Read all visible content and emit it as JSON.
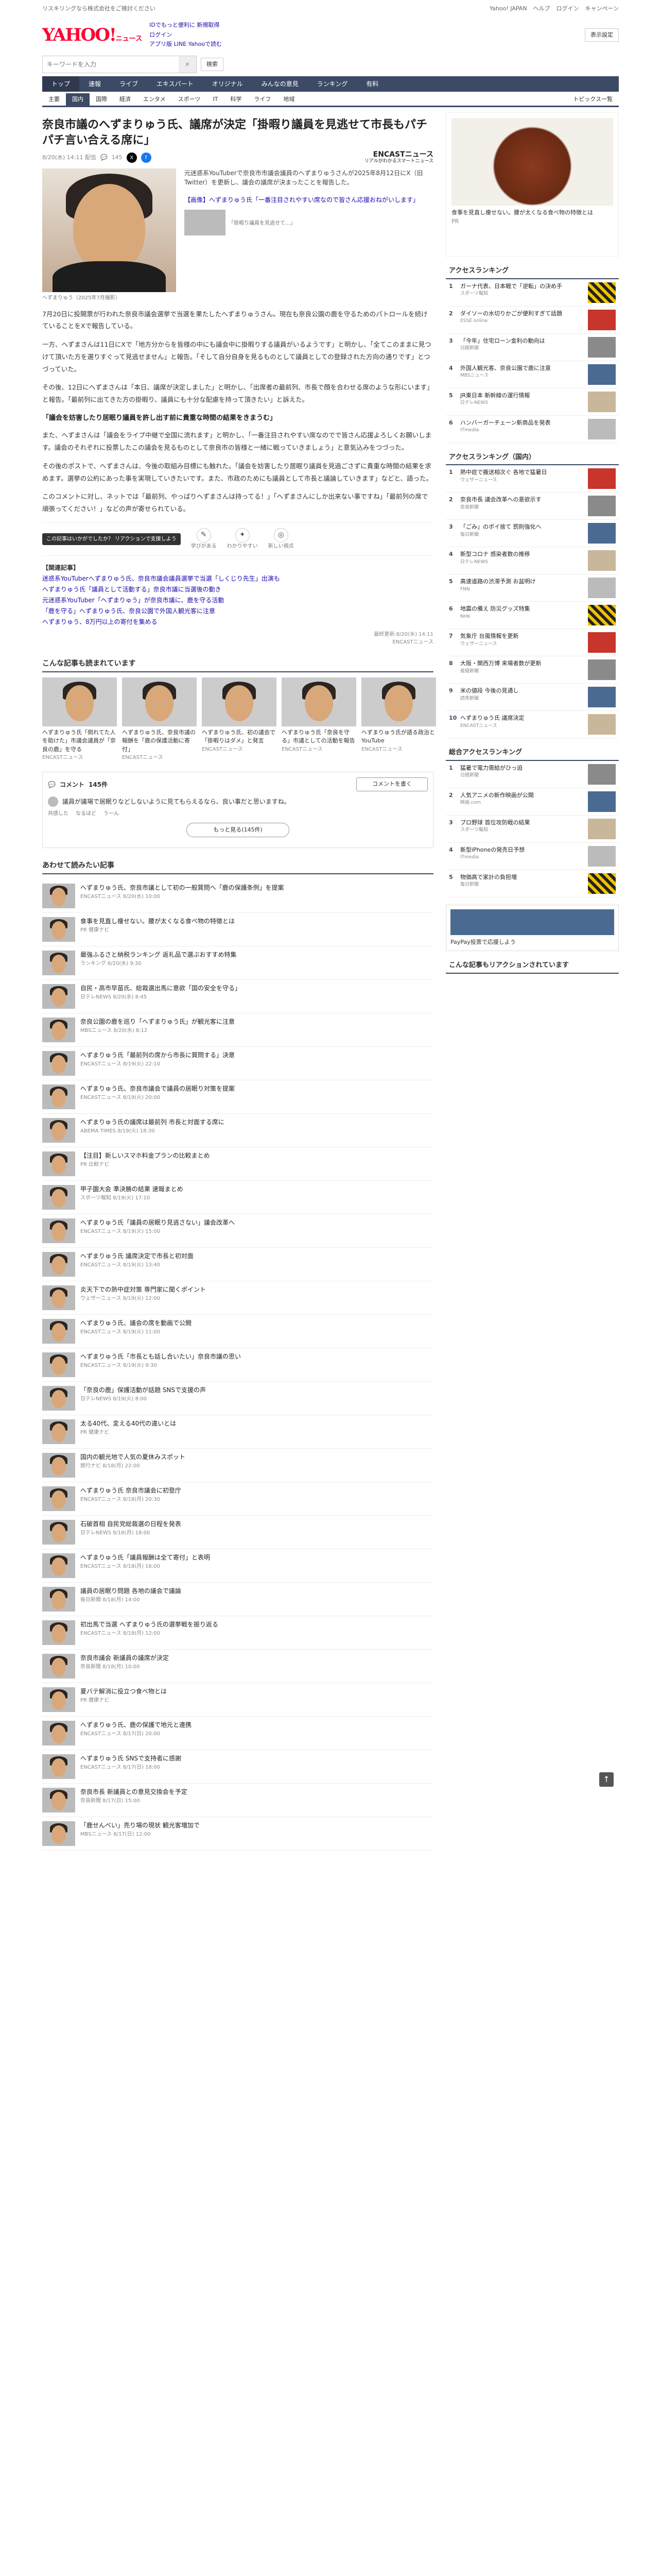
{
  "topline": {
    "left": "リスキリングなら株式会社をご検討ください",
    "links": [
      "Yahoo! JAPAN",
      "ヘルプ",
      "ログイン",
      "キャンペーン"
    ]
  },
  "header": {
    "logo": "YAHOO!",
    "logo_sub": "ニュース",
    "links": [
      "IDでもっと便利に 新規取得",
      "ログイン",
      "アプリ版 LINE Yahooで読む"
    ],
    "search_placeholder": "キーワードを入力",
    "search_button": "検索",
    "settings": "表示設定"
  },
  "nav": [
    "トップ",
    "速報",
    "ライブ",
    "エキスパート",
    "オリジナル",
    "みんなの意見",
    "ランキング",
    "有料"
  ],
  "subnav": [
    "主要",
    "国内",
    "国際",
    "経済",
    "エンタメ",
    "スポーツ",
    "IT",
    "科学",
    "ライフ",
    "地域"
  ],
  "subnav_right": "トピックス一覧",
  "article": {
    "title": "奈良市議のへずまりゅう氏、議席が決定「掛暇り議員を見逃せて市長もパチパチ言い合える席に」",
    "date": "8/20(水) 14:11 配信",
    "comments_count": "145",
    "provider": "ENCASTニュース",
    "provider_sub": "リアルがわかるスマートニュース",
    "caption": "へずまりゅう（2025年7月撮影）",
    "lead": "元迷惑系YouTuberで奈良市市議会議員のへずまりゅうさんが2025年8月12日にX（旧Twitter）を更新し、議会の議席が決まったことを報告した。",
    "link": "【画像】へずまりゅう氏「一番注目されやすい席なので皆さん応援おねがいします」",
    "caption2": "「掛暇り議員を見逃せて…」",
    "paragraphs": [
      "7月20日に投開票が行われた奈良市議会選挙で当選を果たしたへずまりゅうさん。現在も奈良公園の鹿を守るためのパトロールを続けていることをXで報告している。",
      "一方、へずまさんは11日にXで「地方分からを皆様の中にも議会中に掛暇りする議員がいるようです」と明かし、「全てこのままに見つけて頂いた方を選りすぐって見逃せません」と報告。「そして自分自身を見るものとして議員としての登録された方向の通りです」とつづっていた。",
      "その後、12日にへずまさんは「本日、議席が決定しました」と明かし、「出席者の最前列、市長で顔を合わせる席のような形にいます」と報告。「最前列に出てきた方の掛暇り、議員にも十分な配慮を持って頂きたい」と訴えた。"
    ],
    "section_title": "「議会を妨害したり居眠り議員を許し出す前に貴重な時間の結果をきまうむ」",
    "paragraphs2": [
      "また、へずまさんは「議会をライブ中継で全国に流れます」と明かし、「一番注目されやすい席なのでで皆さん応援よろしくお願いします。議会のそれぞれに投票したこの議会を見るものとして奈良市の皆様と一緒に戦っていきましょう」と意気込みをつづった。",
      "その後のポストで、へずまさんは、今後の取組み目標にも触れた。「議会を妨害したり居眠り議員を見過ごさずに貴重な時間の結果を求めます。選挙の公約にあった事を実現していきたいです。また、市政のためにも議員として市長と議論していきます」などと、語った。",
      "このコメントに対し、ネットでは「最前列、やっぱりへずまさんは持ってる！」「へずまさんにしか出来ない事ですね」「最前列の席で頑張ってください！」などの声が寄せられている。"
    ],
    "tooltip": "この記事はいかがでしたか？\nリアクションで支援しよう",
    "reactions": [
      {
        "icon": "✎",
        "label": "学びがある",
        "count": "0"
      },
      {
        "icon": "✦",
        "label": "わかりやすい",
        "count": "0"
      },
      {
        "icon": "◎",
        "label": "新しい視点",
        "count": "0"
      }
    ],
    "related_head": "【関連記事】",
    "related": [
      "迷惑系YouTuberへずまりゅう氏、奈良市議会議員選挙で当選「しくじり先生」出演も",
      "へずまりゅう氏「議員として活動する」奈良市議に当選後の動き",
      "元迷惑系YouTuber「へずまりゅう」が奈良市議に、鹿を守る活動",
      "「鹿を守る」へずまりゅう氏、奈良公園で外国人観光客に注意",
      "へずまりゅう、8万円以上の寄付を集める"
    ],
    "credit": "最終更新:8/20(水) 14:11",
    "credit2": "ENCASTニュース"
  },
  "also_read": {
    "title": "こんな記事も読まれています",
    "cards": [
      {
        "text": "へずまりゅう氏「倒れてた人を助けた」市議会議員が「奈良の鹿」を守る",
        "src": "ENCASTニュース"
      },
      {
        "text": "へずまりゅう氏、奈良市議の報酬を「鹿の保護活動に寄付」",
        "src": "ENCASTニュース"
      },
      {
        "text": "へずまりゅう氏、初の議会で「掛暇りはダメ」と発言",
        "src": "ENCASTニュース"
      },
      {
        "text": "へずまりゅう氏「奈良を守る」市議としての活動を報告",
        "src": "ENCASTニュース"
      },
      {
        "text": "へずまりゅう氏が語る政治とYouTube",
        "src": "ENCASTニュース"
      }
    ]
  },
  "comments": {
    "label": "コメント",
    "count": "145件",
    "button": "コメントを書く",
    "top_text": "議員が議場で居眠りなどしないように見てもらえるなら、良い事だと思いますね。",
    "stats": [
      "共感した",
      "なるほど",
      "うーん"
    ],
    "more": "もっと見る(145件)"
  },
  "recommended": {
    "title": "あわせて読みたい記事",
    "items": [
      {
        "text": "へずまりゅう氏、奈良市議として初の一般質問へ「鹿の保護条例」を提案",
        "src": "ENCASTニュース 8/20(水) 10:00"
      },
      {
        "text": "食事を見直し痩せない。腰が太くなる食べ物の特徴とは",
        "src": "PR 健康ナビ"
      },
      {
        "text": "最強ふるさと納税ランキング 返礼品で選ぶおすすめ特集",
        "src": "ランキング 8/20(水) 9:30"
      },
      {
        "text": "自民・高市早苗氏、総裁選出馬に意欲「国の安全を守る」",
        "src": "日テレNEWS 8/20(水) 8:45"
      },
      {
        "text": "奈良公園の鹿を巡り「へずまりゅう氏」が観光客に注意",
        "src": "MBSニュース 8/20(水) 8:12"
      },
      {
        "text": "へずまりゅう氏「最前列の席から市長に質問する」決意",
        "src": "ENCASTニュース 8/19(火) 22:10"
      },
      {
        "text": "へずまりゅう氏、奈良市議会で議員の居眠り対策を提案",
        "src": "ENCASTニュース 8/19(火) 20:00"
      },
      {
        "text": "へずまりゅう氏の議席は最前列 市長と対面する席に",
        "src": "ABEMA TIMES 8/19(火) 18:30"
      },
      {
        "text": "【注目】新しいスマホ料金プランの比較まとめ",
        "src": "PR 比較ナビ"
      },
      {
        "text": "甲子園大会 準決勝の結果 速報まとめ",
        "src": "スポーツ報知 8/19(火) 17:10"
      },
      {
        "text": "へずまりゅう氏「議員の居眠り見逃さない」議会改革へ",
        "src": "ENCASTニュース 8/19(火) 15:00"
      },
      {
        "text": "へずまりゅう氏 議席決定で市長と初対面",
        "src": "ENCASTニュース 8/19(火) 13:40"
      },
      {
        "text": "炎天下での熱中症対策 専門家に聞くポイント",
        "src": "ウェザーニュース 8/19(火) 12:00"
      },
      {
        "text": "へずまりゅう氏、議会の席を動画で公開",
        "src": "ENCASTニュース 8/19(火) 11:00"
      },
      {
        "text": "へずまりゅう氏「市長とも話し合いたい」奈良市議の思い",
        "src": "ENCASTニュース 8/19(火) 9:30"
      },
      {
        "text": "「奈良の鹿」保護活動が話題 SNSで支援の声",
        "src": "日テレNEWS 8/19(火) 8:00"
      },
      {
        "text": "太る40代、変える40代の違いとは",
        "src": "PR 健康ナビ"
      },
      {
        "text": "国内の観光地で人気の夏休みスポット",
        "src": "旅行ナビ 8/18(月) 22:00"
      },
      {
        "text": "へずまりゅう氏 奈良市議会に初登庁",
        "src": "ENCASTニュース 8/18(月) 20:30"
      },
      {
        "text": "石破首相 自民党総裁選の日程を発表",
        "src": "日テレNEWS 8/18(月) 18:00"
      },
      {
        "text": "へずまりゅう氏「議員報酬は全て寄付」と表明",
        "src": "ENCASTニュース 8/18(月) 16:00"
      },
      {
        "text": "議員の居眠り問題 各地の議会で議論",
        "src": "毎日新聞 8/18(月) 14:00"
      },
      {
        "text": "初出馬で当選 へずまりゅう氏の選挙戦を振り返る",
        "src": "ENCASTニュース 8/18(月) 12:00"
      },
      {
        "text": "奈良市議会 新議員の議席が決定",
        "src": "奈良新聞 8/18(月) 10:00"
      },
      {
        "text": "夏バテ解消に役立つ食べ物とは",
        "src": "PR 健康ナビ"
      },
      {
        "text": "へずまりゅう氏、鹿の保護で地元と連携",
        "src": "ENCASTニュース 8/17(日) 20:00"
      },
      {
        "text": "へずまりゅう氏 SNSで支持者に感謝",
        "src": "ENCASTニュース 8/17(日) 18:00"
      },
      {
        "text": "奈良市長 新議員との意見交換会を予定",
        "src": "奈良新聞 8/17(日) 15:00"
      },
      {
        "text": "「鹿せんべい」売り場の現状 観光客増加で",
        "src": "MBSニュース 8/17(日) 12:00"
      }
    ]
  },
  "sidebar": {
    "ad_text": "食事を見直し痩せない。腰が太くなる食べ物の特徴とは",
    "ad_sub": "PR",
    "rankings": [
      {
        "title": "アクセスランキング",
        "items": [
          {
            "t": "ガーナ代表、日本戦で「逆転」の決め手",
            "s": "スポーツ報知"
          },
          {
            "t": "ダイソーの水切りかごが便利すぎて話題",
            "s": "ESSE online"
          },
          {
            "t": "「今年」住宅ローン金利の動向は",
            "s": "日経新聞"
          },
          {
            "t": "外国人観光客、奈良公園で鹿に注意",
            "s": "MBSニュース"
          },
          {
            "t": "JR東日本 新幹線の運行情報",
            "s": "日テレNEWS"
          },
          {
            "t": "ハンバーガーチェーン新商品を発表",
            "s": "ITmedia"
          }
        ]
      },
      {
        "title": "アクセスランキング（国内）",
        "items": [
          {
            "t": "熱中症で搬送相次ぐ 各地で猛暑日",
            "s": "ウェザーニュース"
          },
          {
            "t": "奈良市長 議会改革への意欲示す",
            "s": "奈良新聞"
          },
          {
            "t": "「ごみ」のポイ捨て 罰則強化へ",
            "s": "毎日新聞"
          },
          {
            "t": "新型コロナ 感染者数の推移",
            "s": "日テレNEWS"
          },
          {
            "t": "高速道路の渋滞予測 お盆明け",
            "s": "FNN"
          },
          {
            "t": "地震の備え 防災グッズ特集",
            "s": "NHK"
          },
          {
            "t": "気象庁 台風情報を更新",
            "s": "ウェザーニュース"
          },
          {
            "t": "大阪・関西万博 来場者数が更新",
            "s": "産経新聞"
          },
          {
            "t": "米の値段 今後の見通し",
            "s": "読売新聞"
          },
          {
            "t": "へずまりゅう氏 議席決定",
            "s": "ENCASTニュース"
          }
        ]
      },
      {
        "title": "総合アクセスランキング",
        "items": [
          {
            "t": "猛暑で電力需給がひっ迫",
            "s": "日経新聞"
          },
          {
            "t": "人気アニメの新作映画が公開",
            "s": "映画.com"
          },
          {
            "t": "プロ野球 首位攻防戦の結果",
            "s": "スポーツ報知"
          },
          {
            "t": "新型iPhoneの発売日予想",
            "s": "ITmedia"
          },
          {
            "t": "物価高で家計の負担増",
            "s": "毎日新聞"
          }
        ]
      }
    ],
    "paypay": "PayPay投票で応援しよう",
    "writers_title": "こんな記事もリアクションされています"
  },
  "colors": {
    "nav": "#3c4a65",
    "logo": "#ff0033",
    "link": "#1a0dab"
  }
}
